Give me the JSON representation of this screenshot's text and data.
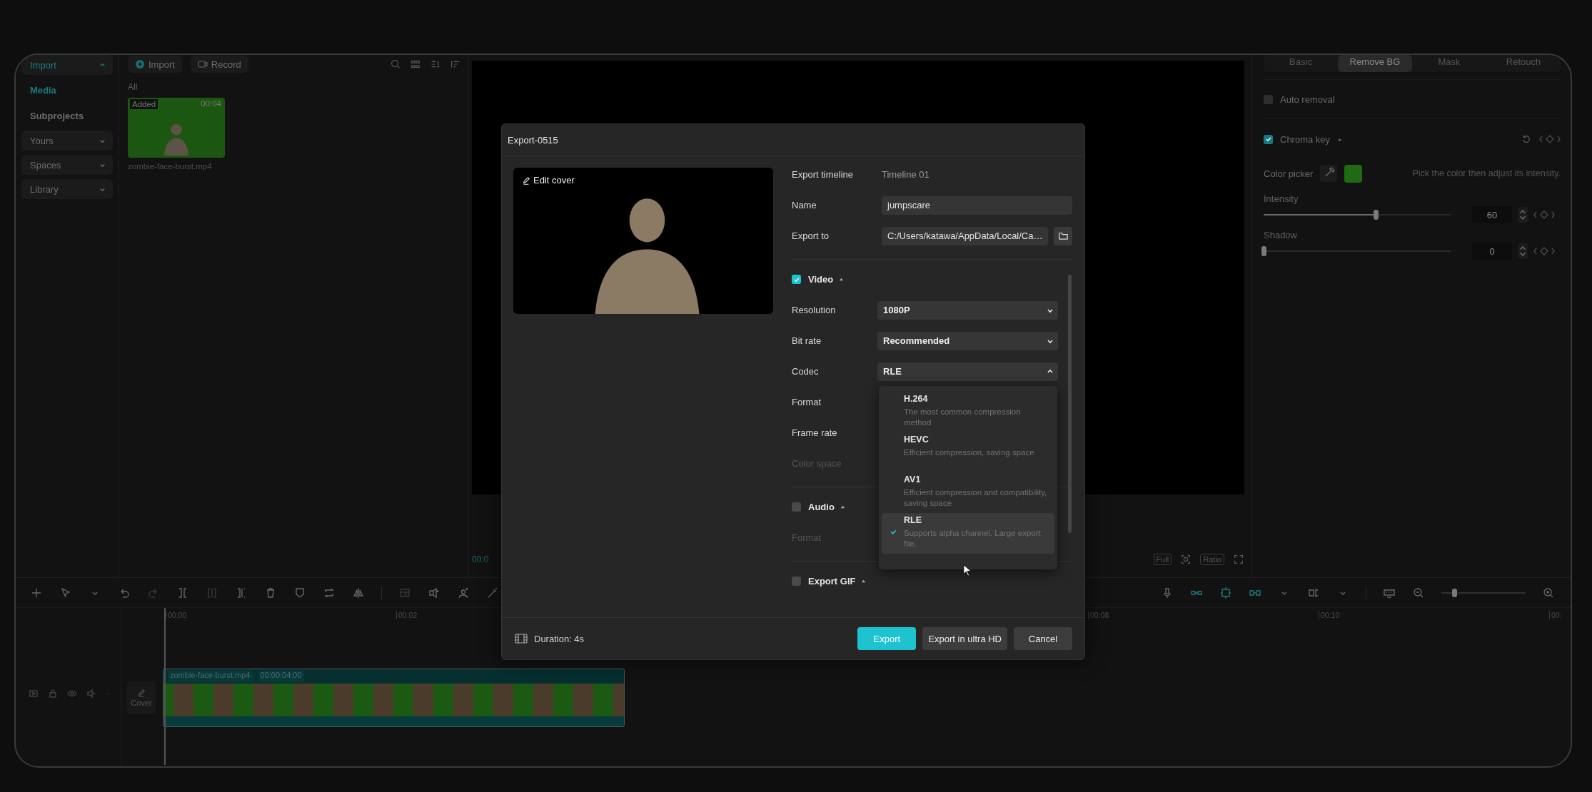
{
  "sidebar": {
    "groups": [
      {
        "label": "Import",
        "selected": true,
        "expanded": true,
        "children": [
          {
            "label": "Media",
            "selected": true
          },
          {
            "label": "Subprojects",
            "selected": false
          }
        ]
      },
      {
        "label": "Yours",
        "selected": false,
        "expanded": false
      },
      {
        "label": "Spaces",
        "selected": false,
        "expanded": false
      },
      {
        "label": "Library",
        "selected": false,
        "expanded": false
      }
    ]
  },
  "media_panel": {
    "buttons": [
      {
        "label": "Import",
        "kind": "import"
      },
      {
        "label": "Record",
        "kind": "record"
      }
    ],
    "filter": "All",
    "items": [
      {
        "badge": "Added",
        "duration": "00:04",
        "filename": "zombie-face-burst.mp4"
      }
    ]
  },
  "player": {
    "time": "00:0",
    "buttons": [
      {
        "label": "Full",
        "kind": "text"
      },
      {
        "kind": "crop"
      },
      {
        "label": "Ratio",
        "kind": "text"
      },
      {
        "kind": "fullscreen"
      }
    ]
  },
  "right_panel": {
    "tabs": [
      {
        "label": "Basic",
        "selected": false
      },
      {
        "label": "Remove BG",
        "selected": true
      },
      {
        "label": "Mask",
        "selected": false
      },
      {
        "label": "Retouch",
        "selected": false
      }
    ],
    "auto_removal": {
      "label": "Auto removal",
      "checked": false
    },
    "chroma_key": {
      "label": "Chroma key",
      "checked": true,
      "expanded": true,
      "color_picker": {
        "label": "Color picker",
        "color": "#1e6b12",
        "hint": "Pick the color then adjust its intensity."
      },
      "sliders": [
        {
          "label": "Intensity",
          "level": 0.6,
          "value": "60"
        },
        {
          "label": "Shadow",
          "level": 0,
          "value": "0"
        }
      ]
    }
  },
  "timeline": {
    "ruler": [
      "00:00",
      "00:02",
      "00:08",
      "00:10",
      "00:"
    ],
    "zoom": {
      "level": 0.15
    },
    "track": {
      "cover_label": "Cover",
      "clip": {
        "name": "zombie-face-burst.mp4",
        "duration": "00:00:04:00"
      }
    }
  },
  "dialog": {
    "title": "Export-0515",
    "cover_button": "Edit cover",
    "fields": [
      {
        "label": "Export timeline",
        "value": "Timeline 01",
        "kind": "text"
      },
      {
        "label": "Name",
        "value": "jumpscare",
        "kind": "input"
      },
      {
        "label": "Export to",
        "value": "C:/Users/katawa/AppData/Local/Ca…",
        "kind": "path"
      }
    ],
    "sections": [
      {
        "label": "Video",
        "checked": true,
        "expanded": true,
        "rows": [
          {
            "label": "Resolution",
            "value": "1080P",
            "open": false,
            "disabled": false
          },
          {
            "label": "Bit rate",
            "value": "Recommended",
            "open": false,
            "disabled": false
          },
          {
            "label": "Codec",
            "value": "RLE",
            "open": true,
            "disabled": false
          },
          {
            "label": "Format",
            "disabled": false
          },
          {
            "label": "Frame rate",
            "disabled": false
          },
          {
            "label": "Color space",
            "disabled": true
          }
        ]
      },
      {
        "label": "Audio",
        "checked": false,
        "expanded": true,
        "rows": [
          {
            "label": "Format",
            "disabled": true
          }
        ]
      },
      {
        "label": "Export GIF",
        "checked": false,
        "expanded": true
      }
    ],
    "codec_menu": [
      {
        "name": "H.264",
        "description": "The most common compression method",
        "selected": false
      },
      {
        "name": "HEVC",
        "description": "Efficient compression, saving space",
        "selected": false
      },
      {
        "name": "AV1",
        "description": "Efficient compression and compatibility, saving space",
        "selected": false
      },
      {
        "name": "RLE",
        "description": "Supports alpha channel. Large export file.",
        "selected": true
      }
    ],
    "duration": "Duration: 4s",
    "buttons": [
      {
        "label": "Export",
        "kind": "primary"
      },
      {
        "label": "Export in ultra HD",
        "kind": "secondary"
      },
      {
        "label": "Cancel",
        "kind": "secondary"
      }
    ]
  }
}
